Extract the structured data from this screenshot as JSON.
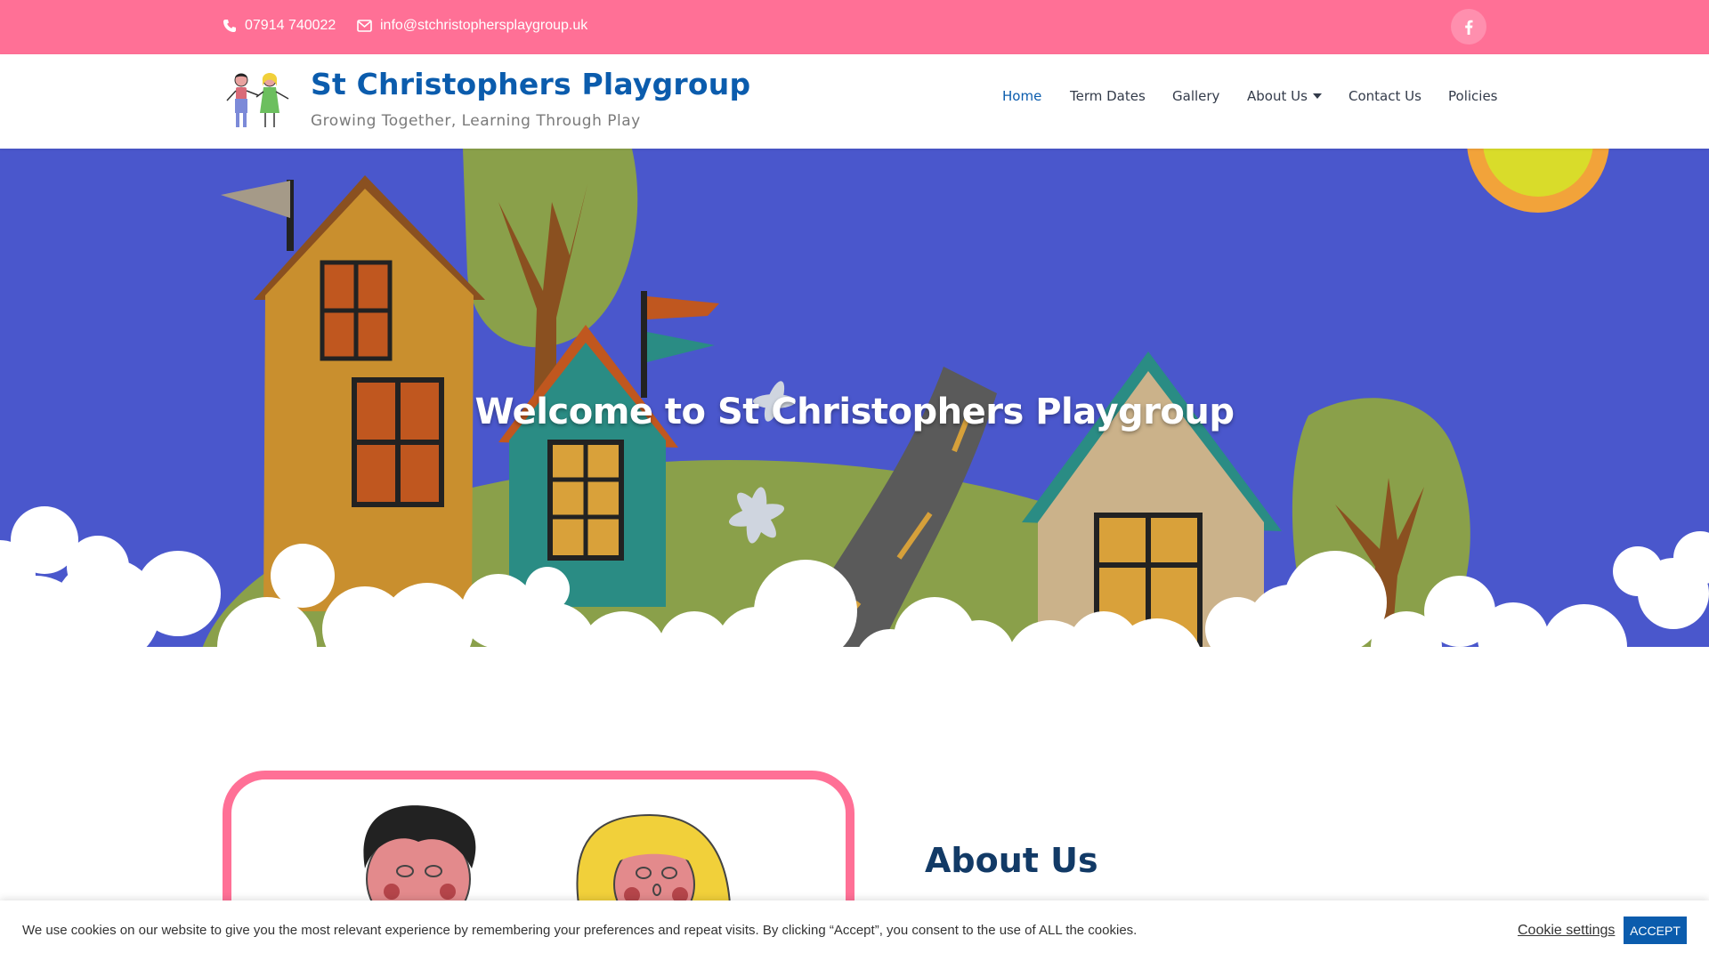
{
  "topbar": {
    "phone": "07914 740022",
    "email": "info@stchristophersplaygroup.uk",
    "social_icon": "facebook-icon"
  },
  "header": {
    "title": "St Christophers Playgroup",
    "tagline": "Growing Together, Learning Through Play"
  },
  "nav": {
    "items": [
      {
        "label": "Home",
        "active": true
      },
      {
        "label": "Term Dates"
      },
      {
        "label": "Gallery"
      },
      {
        "label": "About Us",
        "has_dropdown": true
      },
      {
        "label": "Contact Us"
      },
      {
        "label": "Policies"
      }
    ]
  },
  "hero": {
    "title": "Welcome to St Christophers Playgroup"
  },
  "about": {
    "heading": "About Us"
  },
  "cookie": {
    "message": "We use cookies on our website to give you the most relevant experience by remembering your preferences and repeat visits. By clicking “Accept”, you consent to the use of ALL the cookies.",
    "settings_label": "Cookie settings",
    "accept_label": "ACCEPT"
  },
  "colors": {
    "accent_pink": "#ff7096",
    "brand_blue": "#0b5cad",
    "sky": "#4a57cc",
    "hill_green": "#8aa04a"
  }
}
